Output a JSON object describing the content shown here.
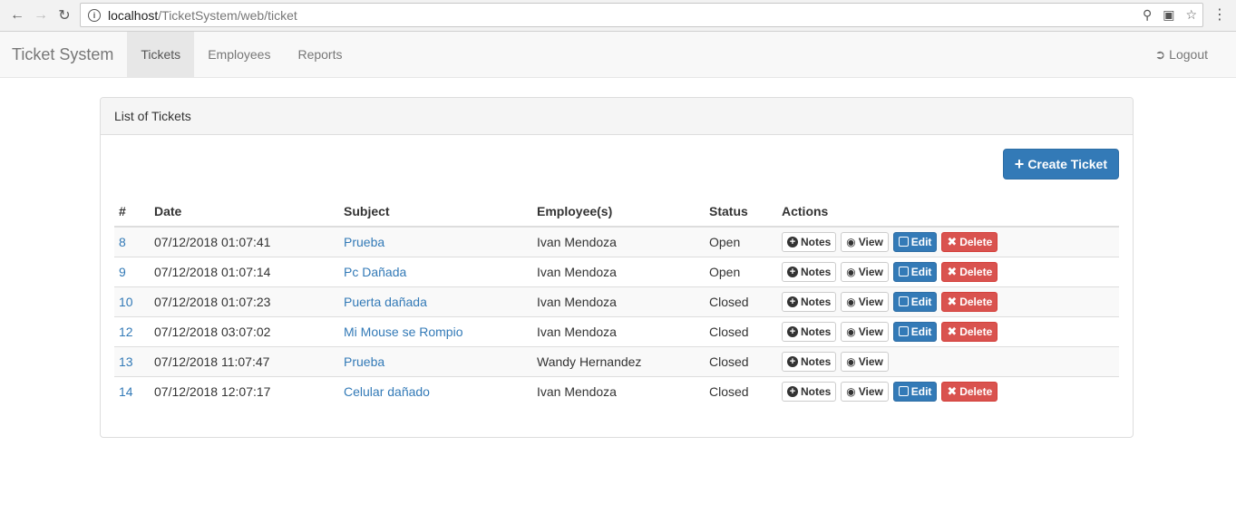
{
  "browser": {
    "url_host": "localhost",
    "url_path": "/TicketSystem/web/ticket"
  },
  "navbar": {
    "brand": "Ticket System",
    "items": [
      {
        "label": "Tickets",
        "active": true
      },
      {
        "label": "Employees",
        "active": false
      },
      {
        "label": "Reports",
        "active": false
      }
    ],
    "logout_label": "Logout"
  },
  "panel": {
    "heading": "List of Tickets",
    "create_button": "Create Ticket"
  },
  "table": {
    "headers": [
      "#",
      "Date",
      "Subject",
      "Employee(s)",
      "Status",
      "Actions"
    ],
    "rows": [
      {
        "id": "8",
        "date": "07/12/2018 01:07:41",
        "subject": "Prueba",
        "employee": "Ivan Mendoza",
        "status": "Open",
        "actions": [
          "Notes",
          "View",
          "Edit",
          "Delete"
        ]
      },
      {
        "id": "9",
        "date": "07/12/2018 01:07:14",
        "subject": "Pc Dañada",
        "employee": "Ivan Mendoza",
        "status": "Open",
        "actions": [
          "Notes",
          "View",
          "Edit",
          "Delete"
        ]
      },
      {
        "id": "10",
        "date": "07/12/2018 01:07:23",
        "subject": "Puerta dañada",
        "employee": "Ivan Mendoza",
        "status": "Closed",
        "actions": [
          "Notes",
          "View",
          "Edit",
          "Delete"
        ]
      },
      {
        "id": "12",
        "date": "07/12/2018 03:07:02",
        "subject": "Mi Mouse se Rompio",
        "employee": "Ivan Mendoza",
        "status": "Closed",
        "actions": [
          "Notes",
          "View",
          "Edit",
          "Delete"
        ]
      },
      {
        "id": "13",
        "date": "07/12/2018 11:07:47",
        "subject": "Prueba",
        "employee": "Wandy Hernandez",
        "status": "Closed",
        "actions": [
          "Notes",
          "View"
        ]
      },
      {
        "id": "14",
        "date": "07/12/2018 12:07:17",
        "subject": "Celular dañado",
        "employee": "Ivan Mendoza",
        "status": "Closed",
        "actions": [
          "Notes",
          "View",
          "Edit",
          "Delete"
        ]
      }
    ]
  },
  "colors": {
    "primary": "#337ab7",
    "danger": "#d9534f",
    "link": "#337ab7"
  }
}
